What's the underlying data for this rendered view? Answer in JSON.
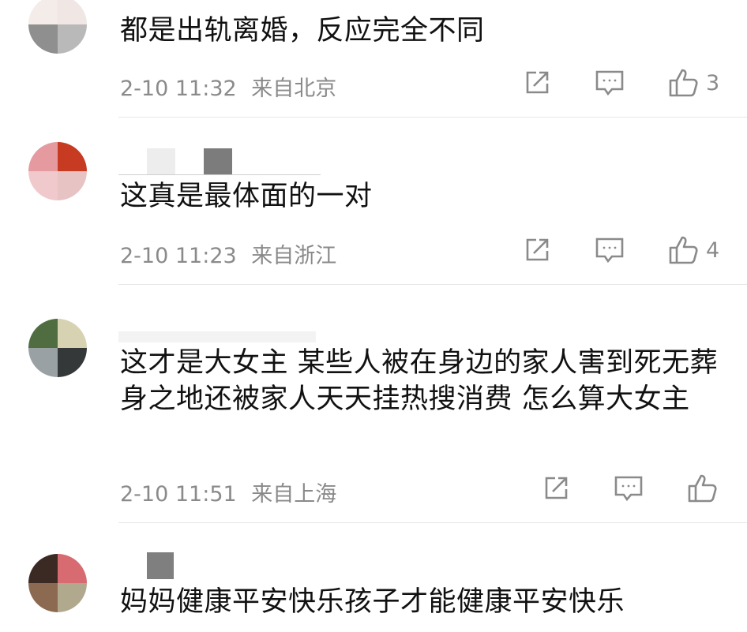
{
  "colors": {
    "text": "#111111",
    "meta": "#8a8a8a",
    "divider": "#e6e6e6"
  },
  "comments": [
    {
      "text": "都是出轨离婚，反应完全不同",
      "time": "2-10 11:32",
      "location": "来自北京",
      "likes": "3",
      "avatar_colors": [
        "#f4ece9",
        "#f0e6e4",
        "#8f8f8f",
        "#b9b9b9"
      ]
    },
    {
      "text": "这真是最体面的一对",
      "time": "2-10 11:23",
      "location": "来自浙江",
      "likes": "4",
      "avatar_colors": [
        "#e59aa0",
        "#c63b22",
        "#f0c9cc",
        "#e7c3c4"
      ]
    },
    {
      "text": "这才是大女主 某些人被在身边的家人害到死无葬身之地还被家人天天挂热搜消费 怎么算大女主",
      "time": "2-10 11:51",
      "location": "来自上海",
      "likes": "",
      "avatar_colors": [
        "#4f6d41",
        "#d7d2b2",
        "#9aa1a5",
        "#343838"
      ]
    },
    {
      "text": "妈妈健康平安快乐孩子才能健康平安快乐",
      "time": "",
      "location": "",
      "likes": "",
      "avatar_colors": [
        "#3b2a24",
        "#d86b72",
        "#8b6a51",
        "#b0a98d"
      ]
    }
  ],
  "icons": {
    "share": "share-icon",
    "comment": "comment-icon",
    "like": "thumbs-up-icon"
  }
}
